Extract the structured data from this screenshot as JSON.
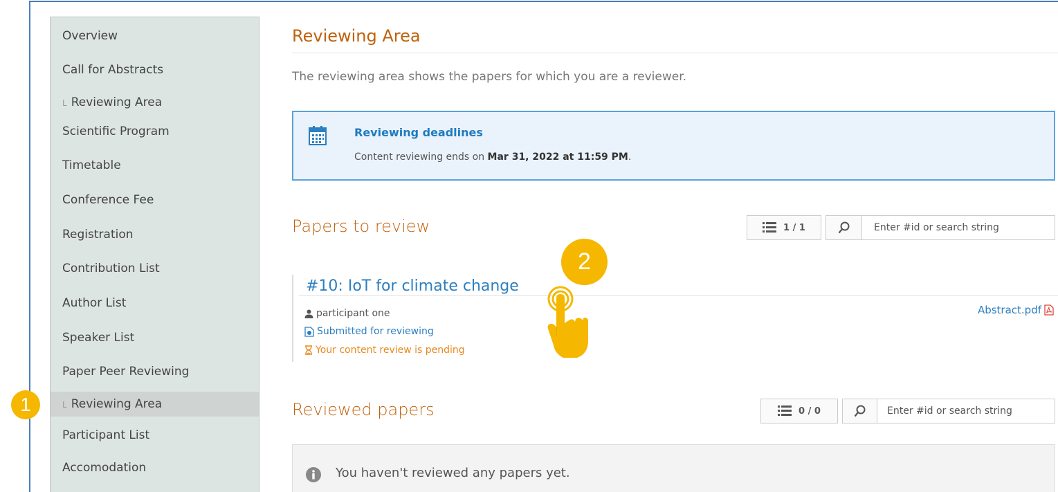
{
  "sidebar": {
    "items": [
      {
        "label": "Overview",
        "sub": false,
        "active": false
      },
      {
        "label": "Call for Abstracts",
        "sub": false,
        "active": false
      },
      {
        "label": "Reviewing Area",
        "sub": true,
        "active": false
      },
      {
        "label": "Scientific Program",
        "sub": false,
        "active": false
      },
      {
        "label": "Timetable",
        "sub": false,
        "active": false
      },
      {
        "label": "Conference Fee",
        "sub": false,
        "active": false
      },
      {
        "label": "Registration",
        "sub": false,
        "active": false
      },
      {
        "label": "Contribution List",
        "sub": false,
        "active": false
      },
      {
        "label": "Author List",
        "sub": false,
        "active": false
      },
      {
        "label": "Speaker List",
        "sub": false,
        "active": false
      },
      {
        "label": "Paper Peer Reviewing",
        "sub": false,
        "active": false
      },
      {
        "label": "Reviewing Area",
        "sub": true,
        "active": true
      },
      {
        "label": "Participant List",
        "sub": false,
        "active": false
      },
      {
        "label": "Accomodation",
        "sub": false,
        "active": false
      }
    ],
    "sub_glyph": "L"
  },
  "main": {
    "title": "Reviewing Area",
    "intro": "The reviewing area shows the papers for which you are a reviewer."
  },
  "deadline": {
    "title": "Reviewing deadlines",
    "text_prefix": "Content reviewing ends on ",
    "text_date": "Mar 31, 2022 at 11:59 PM",
    "text_suffix": "."
  },
  "to_review": {
    "title": "Papers to review",
    "count": "1 / 1",
    "search_placeholder": "Enter #id or search string",
    "papers": [
      {
        "title": "#10: IoT for climate change",
        "author": "participant one",
        "state": "Submitted for reviewing",
        "pending": "Your content review is pending",
        "attachment": "Abstract.pdf"
      }
    ]
  },
  "reviewed": {
    "title": "Reviewed papers",
    "count": "0 / 0",
    "search_placeholder": "Enter #id or search string",
    "empty_text": "You haven't reviewed any papers yet."
  },
  "annotations": {
    "badge1": "1",
    "badge2": "2"
  },
  "colors": {
    "accent_orange": "#c0620c",
    "link_blue": "#2c7fc0",
    "badge_yellow": "#f5b700"
  }
}
